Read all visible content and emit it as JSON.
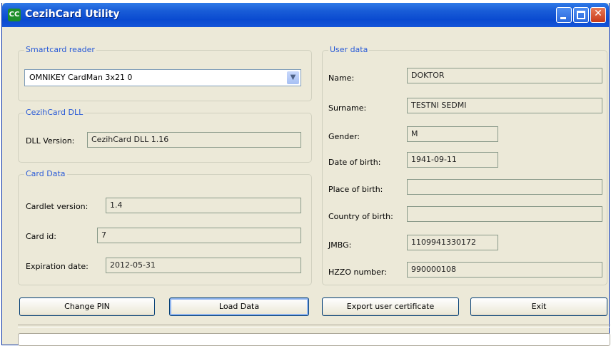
{
  "window": {
    "title": "CezihCard Utility",
    "icon": "CC"
  },
  "title_buttons": {
    "minimize": "minimize-icon",
    "maximize": "maximize-icon",
    "close": "close-icon"
  },
  "smartcard_reader": {
    "legend": "Smartcard reader",
    "selected": "OMNIKEY CardMan 3x21 0"
  },
  "dll": {
    "legend": "CezihCard DLL",
    "version_label": "DLL Version:",
    "version_value": "CezihCard DLL 1.16"
  },
  "card_data": {
    "legend": "Card Data",
    "cardlet_label": "Cardlet version:",
    "cardlet_value": "1.4",
    "card_id_label": "Card id:",
    "card_id_value": "7",
    "expiration_label": "Expiration date:",
    "expiration_value": "2012-05-31"
  },
  "user_data": {
    "legend": "User data",
    "name_label": "Name:",
    "name_value": "DOKTOR",
    "surname_label": "Surname:",
    "surname_value": "TESTNI SEDMI",
    "gender_label": "Gender:",
    "gender_value": "M",
    "dob_label": "Date of birth:",
    "dob_value": "1941-09-11",
    "pob_label": "Place of birth:",
    "pob_value": "",
    "cob_label": "Country of birth:",
    "cob_value": "",
    "jmbg_label": "JMBG:",
    "jmbg_value": "1109941330172",
    "hzzo_label": "HZZO number:",
    "hzzo_value": "990000108"
  },
  "buttons": {
    "change_pin": "Change PIN",
    "load_data": "Load Data",
    "export_cert": "Export user certificate",
    "exit": "Exit"
  }
}
